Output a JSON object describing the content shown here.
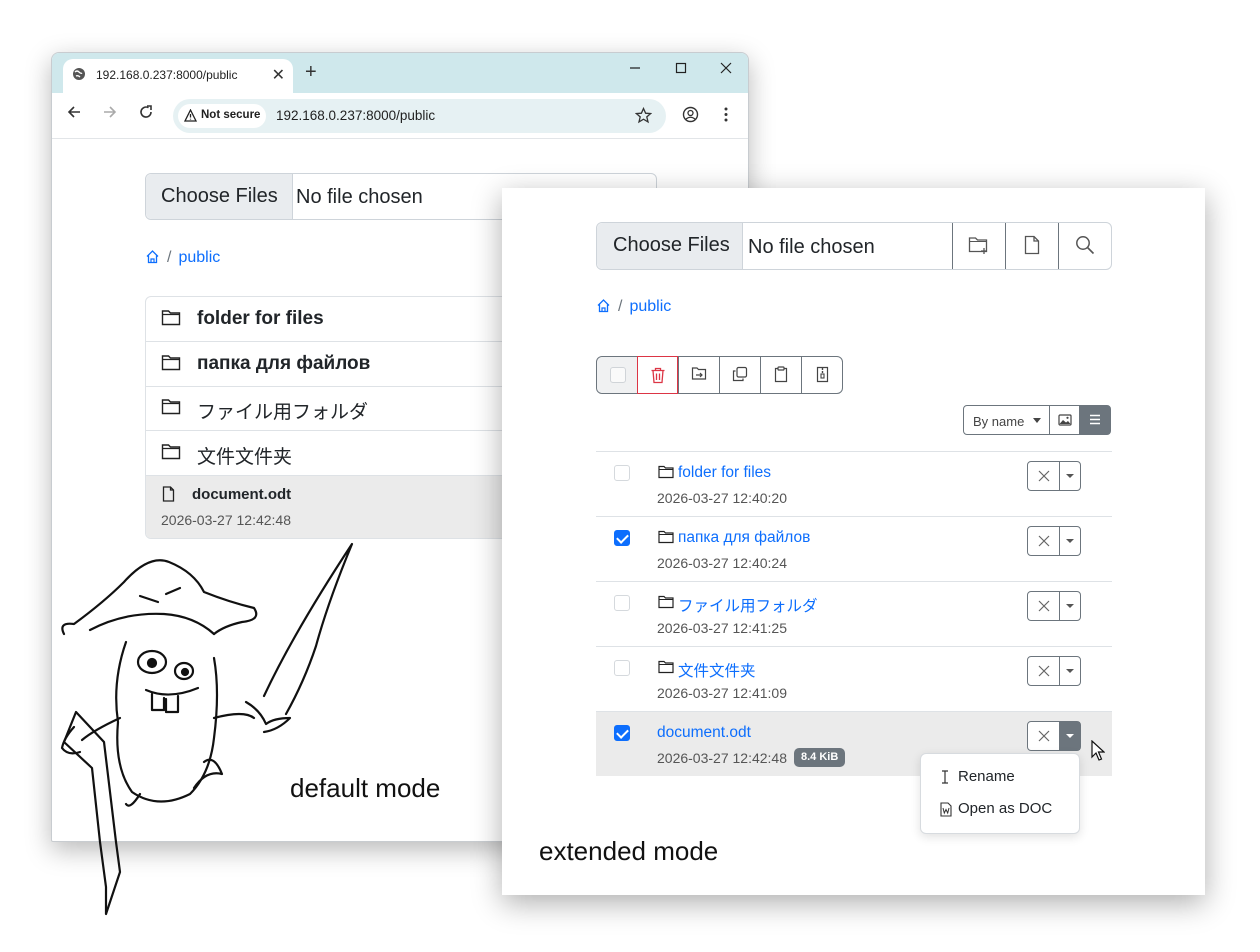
{
  "browser": {
    "tab_title": "192.168.0.237:8000/public",
    "new_tab": "+",
    "security_chip": "Not secure",
    "url": "192.168.0.237:8000/public"
  },
  "upload": {
    "choose_files": "Choose Files",
    "no_file": "No file chosen"
  },
  "breadcrumb": {
    "separator": "/",
    "current": "public"
  },
  "default_mode": {
    "caption": "default mode",
    "folders": [
      "folder for files",
      "папка для файлов",
      "ファイル用フォルダ",
      "文件文件夹"
    ],
    "file": {
      "name": "document.odt",
      "date": "2026-03-27 12:42:48"
    }
  },
  "extended_mode": {
    "caption": "extended mode",
    "sort_label": "By name",
    "rows": [
      {
        "name": "folder for files",
        "date": "2026-03-27 12:40:20",
        "checked": false
      },
      {
        "name": "папка для файлов",
        "date": "2026-03-27 12:40:24",
        "checked": true
      },
      {
        "name": "ファイル用フォルダ",
        "date": "2026-03-27 12:41:25",
        "checked": false
      },
      {
        "name": "文件文件夹",
        "date": "2026-03-27 12:41:09",
        "checked": false
      },
      {
        "name": "document.odt",
        "date": "2026-03-27 12:42:48",
        "checked": true,
        "size": "8.4 KiB"
      }
    ],
    "menu": {
      "rename": "Rename",
      "open_as_doc": "Open as DOC"
    }
  },
  "colors": {
    "accent": "#0d6efd",
    "danger": "#dc3545",
    "secondary": "#6c757d",
    "tabstrip": "#cfe8ec"
  },
  "icons": [
    "globe-icon",
    "close-icon",
    "minimize-icon",
    "maximize-icon",
    "back-icon",
    "forward-icon",
    "reload-icon",
    "warning-icon",
    "star-icon",
    "account-icon",
    "kebab-menu-icon",
    "home-icon",
    "folder-icon",
    "file-icon",
    "new-folder-icon",
    "new-file-icon",
    "search-icon",
    "trash-icon",
    "move-icon",
    "copy-icon",
    "paste-icon",
    "zip-icon",
    "image-view-icon",
    "list-view-icon",
    "cursor-text-icon",
    "word-doc-icon",
    "mouse-pointer-icon"
  ]
}
